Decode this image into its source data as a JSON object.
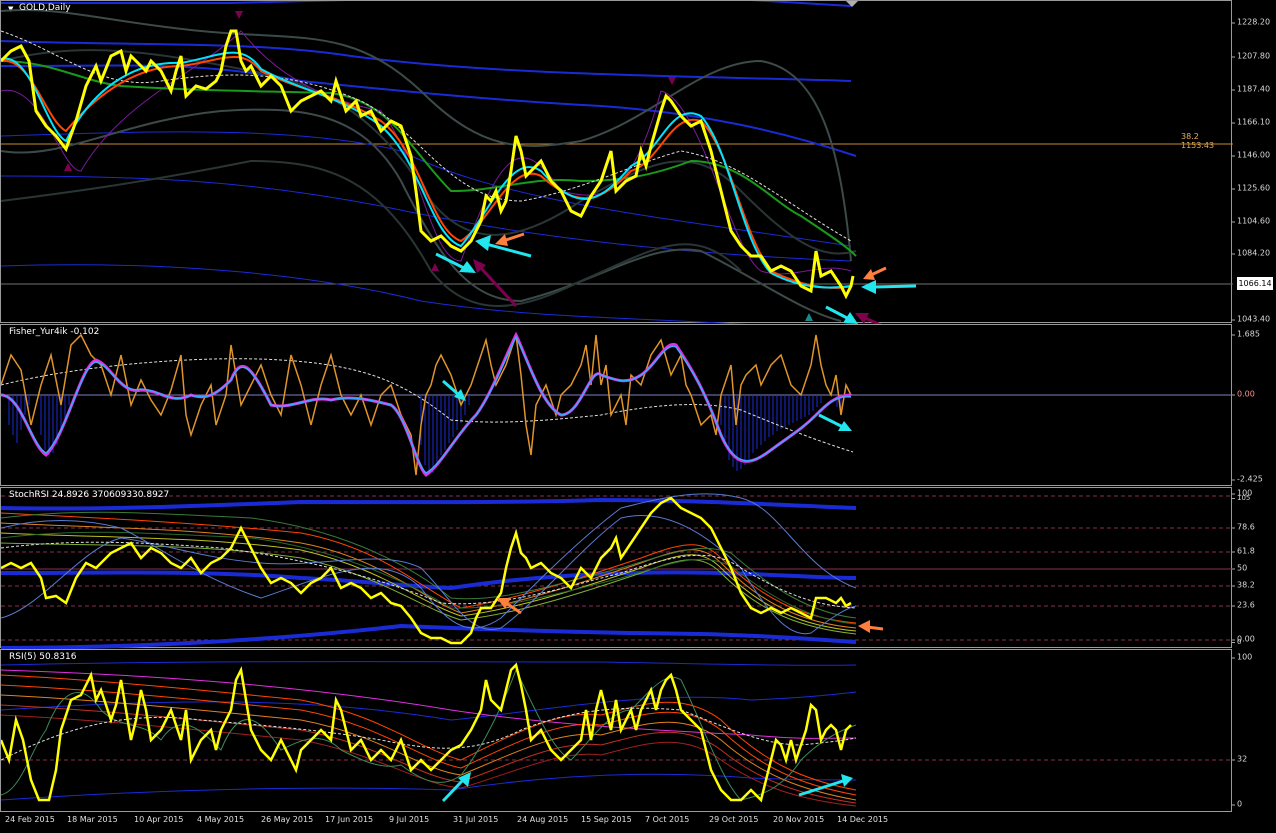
{
  "main": {
    "title": "GOLD,Daily",
    "fib_label": "38.2  1153.43",
    "current_price": "1066.14",
    "price_ticks": [
      "1228.20",
      "1207.80",
      "1187.40",
      "1166.10",
      "1146.00",
      "1125.60",
      "1104.60",
      "1084.20",
      "1043.40"
    ]
  },
  "fisher": {
    "label": "Fisher_Yur4ik -0.102",
    "ticks": [
      "1.685",
      "0.00",
      "-2.425"
    ]
  },
  "stoch": {
    "label": "StochRSI 24.8926 370609330.8927",
    "ticks": [
      "100",
      "105",
      "78.6",
      "61.8",
      "50",
      "38.2",
      "23.6",
      "0.00",
      "0"
    ]
  },
  "rsi": {
    "label": "RSI(5) 50.8316",
    "ticks": [
      "100",
      "32",
      "0"
    ]
  },
  "xaxis": {
    "labels": [
      "24 Feb 2015",
      "18 Mar 2015",
      "10 Apr 2015",
      "4 May 2015",
      "26 May 2015",
      "17 Jun 2015",
      "9 Jul 2015",
      "31 Jul 2015",
      "24 Aug 2015",
      "15 Sep 2015",
      "7 Oct 2015",
      "29 Oct 2015",
      "20 Nov 2015",
      "14 Dec 2015"
    ]
  },
  "colors": {
    "price": "#ffff00",
    "fast_ma": "#00e5ff",
    "slow_ma": "#ff4500",
    "ma_green": "#1a9a1a",
    "channel": "#1a2bd6",
    "bands": "#3d4a4a",
    "arrow_cyan": "#22e5ee",
    "arrow_orange": "#ff7f3f",
    "arrow_purple": "#800050",
    "fisher_line": "#e0952a",
    "fisher_hist": "#1a2bd6",
    "signal_magenta": "#e030e0"
  }
}
